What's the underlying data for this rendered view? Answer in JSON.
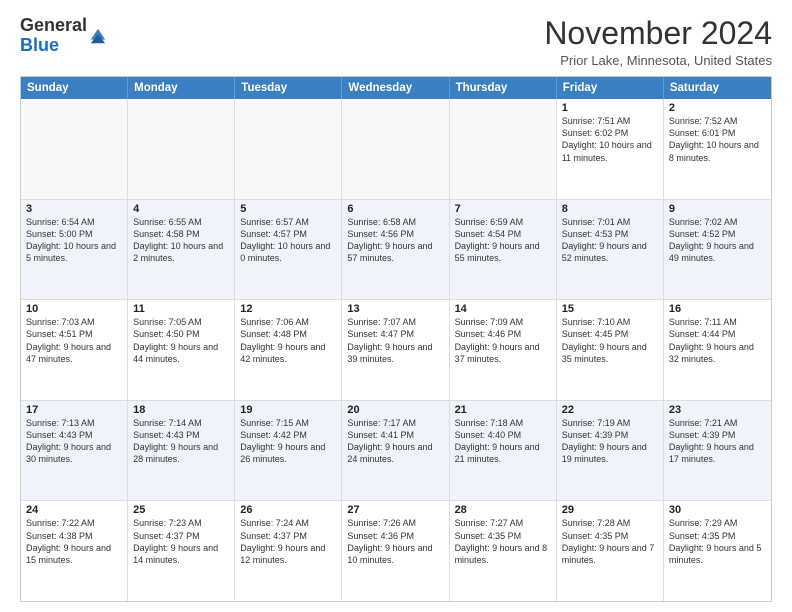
{
  "logo": {
    "general": "General",
    "blue": "Blue"
  },
  "header": {
    "month_year": "November 2024",
    "location": "Prior Lake, Minnesota, United States"
  },
  "weekdays": [
    "Sunday",
    "Monday",
    "Tuesday",
    "Wednesday",
    "Thursday",
    "Friday",
    "Saturday"
  ],
  "rows": [
    {
      "alt": false,
      "cells": [
        {
          "day": "",
          "info": ""
        },
        {
          "day": "",
          "info": ""
        },
        {
          "day": "",
          "info": ""
        },
        {
          "day": "",
          "info": ""
        },
        {
          "day": "",
          "info": ""
        },
        {
          "day": "1",
          "info": "Sunrise: 7:51 AM\nSunset: 6:02 PM\nDaylight: 10 hours and 11 minutes."
        },
        {
          "day": "2",
          "info": "Sunrise: 7:52 AM\nSunset: 6:01 PM\nDaylight: 10 hours and 8 minutes."
        }
      ]
    },
    {
      "alt": true,
      "cells": [
        {
          "day": "3",
          "info": "Sunrise: 6:54 AM\nSunset: 5:00 PM\nDaylight: 10 hours and 5 minutes."
        },
        {
          "day": "4",
          "info": "Sunrise: 6:55 AM\nSunset: 4:58 PM\nDaylight: 10 hours and 2 minutes."
        },
        {
          "day": "5",
          "info": "Sunrise: 6:57 AM\nSunset: 4:57 PM\nDaylight: 10 hours and 0 minutes."
        },
        {
          "day": "6",
          "info": "Sunrise: 6:58 AM\nSunset: 4:56 PM\nDaylight: 9 hours and 57 minutes."
        },
        {
          "day": "7",
          "info": "Sunrise: 6:59 AM\nSunset: 4:54 PM\nDaylight: 9 hours and 55 minutes."
        },
        {
          "day": "8",
          "info": "Sunrise: 7:01 AM\nSunset: 4:53 PM\nDaylight: 9 hours and 52 minutes."
        },
        {
          "day": "9",
          "info": "Sunrise: 7:02 AM\nSunset: 4:52 PM\nDaylight: 9 hours and 49 minutes."
        }
      ]
    },
    {
      "alt": false,
      "cells": [
        {
          "day": "10",
          "info": "Sunrise: 7:03 AM\nSunset: 4:51 PM\nDaylight: 9 hours and 47 minutes."
        },
        {
          "day": "11",
          "info": "Sunrise: 7:05 AM\nSunset: 4:50 PM\nDaylight: 9 hours and 44 minutes."
        },
        {
          "day": "12",
          "info": "Sunrise: 7:06 AM\nSunset: 4:48 PM\nDaylight: 9 hours and 42 minutes."
        },
        {
          "day": "13",
          "info": "Sunrise: 7:07 AM\nSunset: 4:47 PM\nDaylight: 9 hours and 39 minutes."
        },
        {
          "day": "14",
          "info": "Sunrise: 7:09 AM\nSunset: 4:46 PM\nDaylight: 9 hours and 37 minutes."
        },
        {
          "day": "15",
          "info": "Sunrise: 7:10 AM\nSunset: 4:45 PM\nDaylight: 9 hours and 35 minutes."
        },
        {
          "day": "16",
          "info": "Sunrise: 7:11 AM\nSunset: 4:44 PM\nDaylight: 9 hours and 32 minutes."
        }
      ]
    },
    {
      "alt": true,
      "cells": [
        {
          "day": "17",
          "info": "Sunrise: 7:13 AM\nSunset: 4:43 PM\nDaylight: 9 hours and 30 minutes."
        },
        {
          "day": "18",
          "info": "Sunrise: 7:14 AM\nSunset: 4:43 PM\nDaylight: 9 hours and 28 minutes."
        },
        {
          "day": "19",
          "info": "Sunrise: 7:15 AM\nSunset: 4:42 PM\nDaylight: 9 hours and 26 minutes."
        },
        {
          "day": "20",
          "info": "Sunrise: 7:17 AM\nSunset: 4:41 PM\nDaylight: 9 hours and 24 minutes."
        },
        {
          "day": "21",
          "info": "Sunrise: 7:18 AM\nSunset: 4:40 PM\nDaylight: 9 hours and 21 minutes."
        },
        {
          "day": "22",
          "info": "Sunrise: 7:19 AM\nSunset: 4:39 PM\nDaylight: 9 hours and 19 minutes."
        },
        {
          "day": "23",
          "info": "Sunrise: 7:21 AM\nSunset: 4:39 PM\nDaylight: 9 hours and 17 minutes."
        }
      ]
    },
    {
      "alt": false,
      "cells": [
        {
          "day": "24",
          "info": "Sunrise: 7:22 AM\nSunset: 4:38 PM\nDaylight: 9 hours and 15 minutes."
        },
        {
          "day": "25",
          "info": "Sunrise: 7:23 AM\nSunset: 4:37 PM\nDaylight: 9 hours and 14 minutes."
        },
        {
          "day": "26",
          "info": "Sunrise: 7:24 AM\nSunset: 4:37 PM\nDaylight: 9 hours and 12 minutes."
        },
        {
          "day": "27",
          "info": "Sunrise: 7:26 AM\nSunset: 4:36 PM\nDaylight: 9 hours and 10 minutes."
        },
        {
          "day": "28",
          "info": "Sunrise: 7:27 AM\nSunset: 4:35 PM\nDaylight: 9 hours and 8 minutes."
        },
        {
          "day": "29",
          "info": "Sunrise: 7:28 AM\nSunset: 4:35 PM\nDaylight: 9 hours and 7 minutes."
        },
        {
          "day": "30",
          "info": "Sunrise: 7:29 AM\nSunset: 4:35 PM\nDaylight: 9 hours and 5 minutes."
        }
      ]
    }
  ]
}
